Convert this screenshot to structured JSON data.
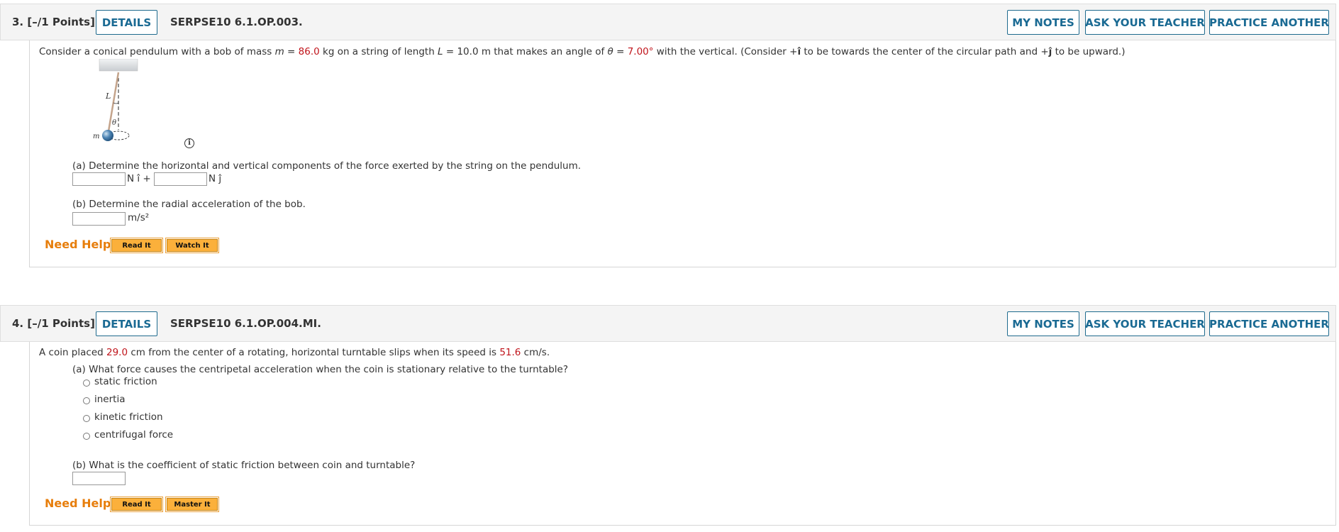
{
  "q3": {
    "number_points": "3.  [–/1 Points]",
    "details_label": "DETAILS",
    "code": "SERPSE10 6.1.OP.003.",
    "my_notes_label": "MY NOTES",
    "ask_teacher_label": "ASK YOUR TEACHER",
    "practice_label": "PRACTICE ANOTHER",
    "intro_1": "Consider a conical pendulum with a bob of mass ",
    "intro_m": "m",
    "intro_2": " = ",
    "mass_value": "86.0",
    "intro_3": " kg on a string of length ",
    "intro_L": "L",
    "intro_4": " = 10.0 m that makes an angle of ",
    "intro_theta": "θ",
    "intro_5": " = ",
    "angle_value": "7.00°",
    "intro_6": " with the vertical. (Consider +",
    "i_hat": "î",
    "intro_7": " to be towards the center of the circular path and +",
    "j_hat": "ĵ",
    "intro_8": " to be upward.)",
    "diagram": {
      "label_L": "L",
      "label_theta": "θ",
      "label_m": "m",
      "info_glyph": "i"
    },
    "part_a": "(a) Determine the horizontal and vertical components of the force exerted by the string on the pendulum.",
    "unit_i": "N î +",
    "unit_j": "N ĵ",
    "part_b": "(b) Determine the radial acceleration of the bob.",
    "unit_b": "m/s²",
    "need_help": "Need Help?",
    "read_it": "Read It",
    "watch_it": "Watch It"
  },
  "q4": {
    "number_points": "4.  [–/1 Points]",
    "details_label": "DETAILS",
    "code": "SERPSE10 6.1.OP.004.MI.",
    "my_notes_label": "MY NOTES",
    "ask_teacher_label": "ASK YOUR TEACHER",
    "practice_label": "PRACTICE ANOTHER",
    "intro_1": "A coin placed ",
    "distance_value": "29.0",
    "intro_2": " cm from the center of a rotating, horizontal turntable slips when its speed is ",
    "speed_value": "51.6",
    "intro_3": " cm/s.",
    "part_a": "(a) What force causes the centripetal acceleration when the coin is stationary relative to the turntable?",
    "options": [
      "static friction",
      "inertia",
      "kinetic friction",
      "centrifugal force"
    ],
    "part_b": "(b) What is the coefficient of static friction between coin and turntable?",
    "need_help": "Need Help?",
    "read_it": "Read It",
    "master_it": "Master It"
  },
  "colors": {
    "accent": "#1a6a93",
    "highlight_red": "#c0141b",
    "need_help_orange": "#e77e0c",
    "help_button": "#fbb03b"
  }
}
